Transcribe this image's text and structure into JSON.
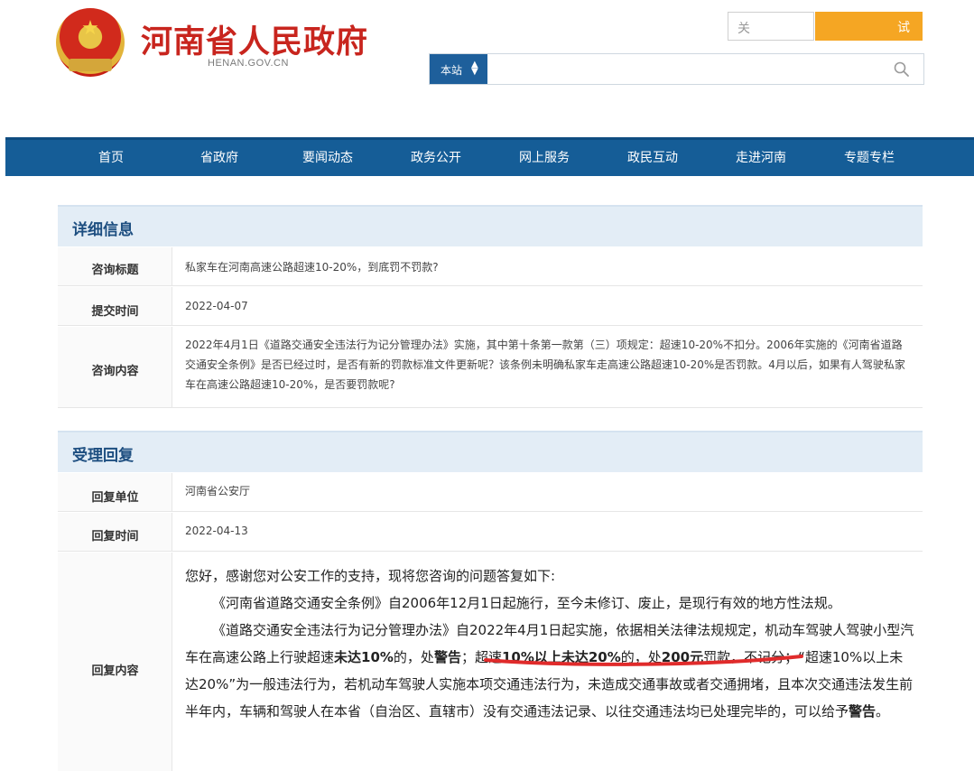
{
  "header": {
    "site_title": "河南省人民政府",
    "site_domain": "HENAN.GOV.CN",
    "top_search_placeholder": "关",
    "top_search_button": "试",
    "search_scope": "本站",
    "search_icon": "search-icon",
    "emblem_icon": "national-emblem-icon"
  },
  "nav": {
    "items": [
      "首页",
      "省政府",
      "要闻动态",
      "政务公开",
      "网上服务",
      "政民互动",
      "走进河南",
      "专题专栏"
    ]
  },
  "detail": {
    "heading": "详细信息",
    "rows": [
      {
        "label": "咨询标题",
        "value": "私家车在河南高速公路超速10-20%，到底罚不罚款?"
      },
      {
        "label": "提交时间",
        "value": "2022-04-07"
      },
      {
        "label": "咨询内容",
        "value": "2022年4月1日《道路交通安全违法行为记分管理办法》实施，其中第十条第一款第（三）项规定：超速10-20%不扣分。2006年实施的《河南省道路交通安全条例》是否已经过时，是否有新的罚款标准文件更新呢？该条例未明确私家车走高速公路超速10-20%是否罚款。4月以后，如果有人驾驶私家车在高速公路超速10-20%，是否要罚款呢?"
      }
    ]
  },
  "reply": {
    "heading": "受理回复",
    "unit_label": "回复单位",
    "unit_value": "河南省公安厅",
    "time_label": "回复时间",
    "time_value": "2022-04-13",
    "content_label": "回复内容",
    "p1": "您好，感谢您对公安工作的支持，现将您咨询的问题答复如下:",
    "p2": "《河南省道路交通安全条例》自2006年12月1日起施行，至今未修订、废止，是现行有效的地方性法规。",
    "p3_a": "《道路交通安全违法行为记分管理办法》自2022年4月1日起实施，依据相关法律法规规定，机动车驾驶人驾驶小型汽车在高速公路上行驶超速",
    "p3_b": "未达10%",
    "p3_c": "的，处",
    "p3_d": "警告",
    "p3_e": "；超速",
    "p3_f": "10%以上未达20%",
    "p3_g": "的，处",
    "p3_h": "200元",
    "p3_i": "罚款，不记分；“超速10%以上未达20%”为一般违法行为，若机动车驾驶人实施本项交通违法行为，未造成交通事故或者交通拥堵，且本次交通违法发生前半年内，车辆和驾驶人在本省（自治区、直辖市）没有交通违法记录、以往交通违法均已处理完毕的，可以给予",
    "p3_j": "警告",
    "p3_k": "。",
    "annotation_color": "#e02b2b"
  }
}
